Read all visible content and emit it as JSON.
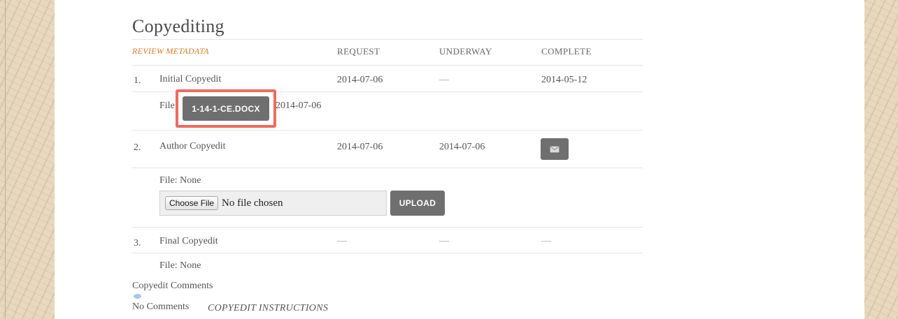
{
  "page_title": "Copyediting",
  "columns": {
    "review_metadata": "REVIEW METADATA",
    "request": "REQUEST",
    "underway": "UNDERWAY",
    "complete": "COMPLETE"
  },
  "rows": [
    {
      "number": "1.",
      "name": "Initial Copyedit",
      "request": "2014-07-06",
      "underway": "—",
      "complete": "2014-05-12",
      "file_label": "File:",
      "file_button": "1-14-1-CE.DOCX",
      "file_date": "2014-07-06"
    },
    {
      "number": "2.",
      "name": "Author Copyedit",
      "request": "2014-07-06",
      "underway": "2014-07-06",
      "complete_icon": "email-icon",
      "file_text": "File: None",
      "choose_file": "Choose File",
      "no_file_chosen": "No file chosen",
      "upload": "UPLOAD"
    },
    {
      "number": "3.",
      "name": "Final Copyedit",
      "request": "—",
      "underway": "—",
      "complete": "—",
      "file_text": "File: None"
    }
  ],
  "comments": {
    "label": "Copyedit Comments",
    "icon": "comment-icon",
    "none_text": "No Comments",
    "instructions": "COPYEDIT INSTRUCTIONS"
  },
  "colors": {
    "link": "#e07a1f",
    "highlight": "#ef6b5e",
    "button": "#6f6f6f"
  }
}
